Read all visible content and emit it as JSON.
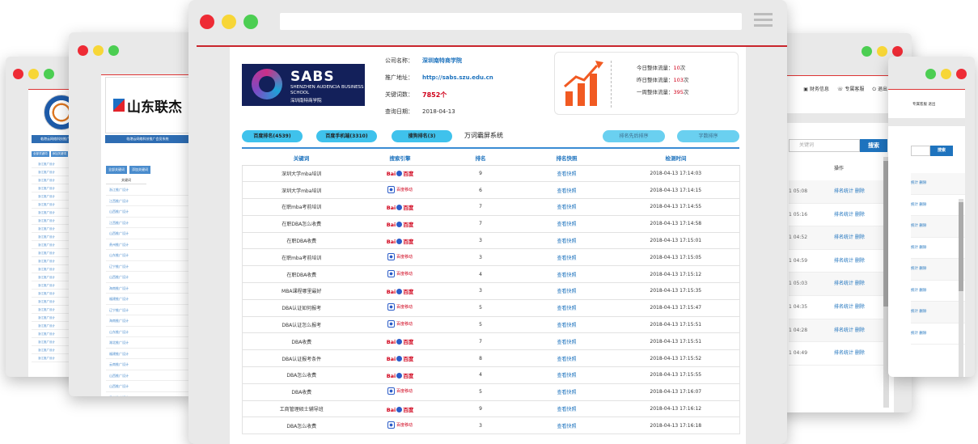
{
  "far_left_window": {
    "banner": "临港云网络科技推广会员系统",
    "buttons": [
      "全部关键词",
      "添加关键词"
    ],
    "rows": [
      "浙江推广设计",
      "浙江推广设计",
      "浙江推广设计",
      "浙江推广设计",
      "浙江推广设计",
      "浙江推广设计",
      "浙江推广设计",
      "浙江推广设计",
      "浙江推广设计",
      "浙江推广设计",
      "浙江推广设计",
      "浙江推广设计",
      "浙江推广设计",
      "浙江推广设计",
      "浙江推广设计",
      "浙江推广设计",
      "浙江推广设计",
      "浙江推广设计",
      "浙江推广设计",
      "浙江推广设计",
      "浙江推广设计",
      "浙江推广设计",
      "浙江推广设计",
      "浙江推广设计",
      "浙江推广设计"
    ]
  },
  "left_window": {
    "logo_text": "山东联杰",
    "banner": "临港云网络科技推广会员系统",
    "buttons": [
      "全部关键词",
      "添加关键词"
    ],
    "column_header": "关键词",
    "rows": [
      "浙江推广设计",
      "江西推广设计",
      "山西推广设计",
      "江西推广设计",
      "山西推广设计",
      "贵州推广设计",
      "山东推广设计",
      "辽宁推广设计",
      "山西推广设计",
      "海南推广设计",
      "福建推广设计",
      "辽宁推广设计",
      "海南推广设计",
      "山东推广设计",
      "湖北推广设计",
      "福建推广设计",
      "云南推广设计",
      "山西推广设计",
      "山西推广设计",
      "云南推广设计",
      "湖北推广设计",
      "河北推广设计"
    ]
  },
  "main_window": {
    "logo": {
      "title": "SABS",
      "subtitle": "SHENZHEN AUDENCIA BUSINESS SCHOOL",
      "cn": "深圳南特商学院"
    },
    "company_label": "公司名称：",
    "company_value": "深圳南特商学院",
    "url_label": "推广地址：",
    "url_value": "http://sabs.szu.edu.cn",
    "keywords_label": "关键词数：",
    "keywords_value": "7852个",
    "date_label": "查询日期：",
    "date_value": "2018-04-13",
    "stats": [
      {
        "label": "今日整体流量：",
        "value": "10",
        "unit": "次"
      },
      {
        "label": "昨日整体流量：",
        "value": "103",
        "unit": "次"
      },
      {
        "label": "一周整体流量：",
        "value": "395",
        "unit": "次"
      }
    ],
    "tabs": [
      "百度排名(4539)",
      "百度手机端(3310)",
      "搜狗排名(3)"
    ],
    "tab_plain": "万词霸屏系统",
    "tab_right": [
      "排名先后排序",
      "字数排序"
    ],
    "columns": [
      "关键词",
      "搜索引擎",
      "排名",
      "排名快照",
      "检测时间"
    ],
    "snapshot_label": "查看快照",
    "rows": [
      {
        "keyword": "深圳大学mba培训",
        "engine": "baidu",
        "rank": "9",
        "time": "2018-04-13 17:14:03"
      },
      {
        "keyword": "深圳大学mba培训",
        "engine": "mobile",
        "rank": "6",
        "time": "2018-04-13 17:14:15"
      },
      {
        "keyword": "在职mba考前培训",
        "engine": "baidu",
        "rank": "7",
        "time": "2018-04-13 17:14:55"
      },
      {
        "keyword": "在职DBA怎么收费",
        "engine": "baidu",
        "rank": "7",
        "time": "2018-04-13 17:14:58"
      },
      {
        "keyword": "在职DBA收费",
        "engine": "baidu",
        "rank": "3",
        "time": "2018-04-13 17:15:01"
      },
      {
        "keyword": "在职mba考前培训",
        "engine": "mobile",
        "rank": "3",
        "time": "2018-04-13 17:15:05"
      },
      {
        "keyword": "在职DBA收费",
        "engine": "mobile",
        "rank": "4",
        "time": "2018-04-13 17:15:12"
      },
      {
        "keyword": "MBA课程哪里最好",
        "engine": "baidu",
        "rank": "3",
        "time": "2018-04-13 17:15:35"
      },
      {
        "keyword": "DBA认证如何报考",
        "engine": "mobile",
        "rank": "5",
        "time": "2018-04-13 17:15:47"
      },
      {
        "keyword": "DBA认证怎么报考",
        "engine": "mobile",
        "rank": "5",
        "time": "2018-04-13 17:15:51"
      },
      {
        "keyword": "DBA收费",
        "engine": "baidu",
        "rank": "7",
        "time": "2018-04-13 17:15:51"
      },
      {
        "keyword": "DBA认证报考条件",
        "engine": "baidu",
        "rank": "8",
        "time": "2018-04-13 17:15:52"
      },
      {
        "keyword": "DBA怎么收费",
        "engine": "baidu",
        "rank": "4",
        "time": "2018-04-13 17:15:55"
      },
      {
        "keyword": "DBA收费",
        "engine": "mobile",
        "rank": "5",
        "time": "2018-04-13 17:16:07"
      },
      {
        "keyword": "工商管理硕士辅导班",
        "engine": "baidu",
        "rank": "9",
        "time": "2018-04-13 17:16:12"
      },
      {
        "keyword": "DBA怎么收费",
        "engine": "mobile",
        "rank": "3",
        "time": "2018-04-13 17:16:18"
      }
    ]
  },
  "right_window": {
    "nav": [
      "财务信息",
      "专属客服",
      "退出"
    ],
    "search_placeholder": "关键词",
    "search_button": "搜索",
    "action_header": "操作",
    "action_links": "排名统计 删除",
    "times": [
      "1 05:08",
      "1 05:16",
      "1 04:52",
      "1 04:59",
      "1 05:03",
      "1 04:35",
      "1 04:28",
      "1 04:49"
    ]
  },
  "far_right_window": {
    "nav": "专属客服 退出",
    "search_button": "搜索",
    "action_links": "统计 删除",
    "rows_count_label": ""
  },
  "colors": {
    "accent_blue": "#1e73be",
    "tab_cyan": "#3fc2ec",
    "red": "#d0021b",
    "window_red": "#ee2b35"
  }
}
